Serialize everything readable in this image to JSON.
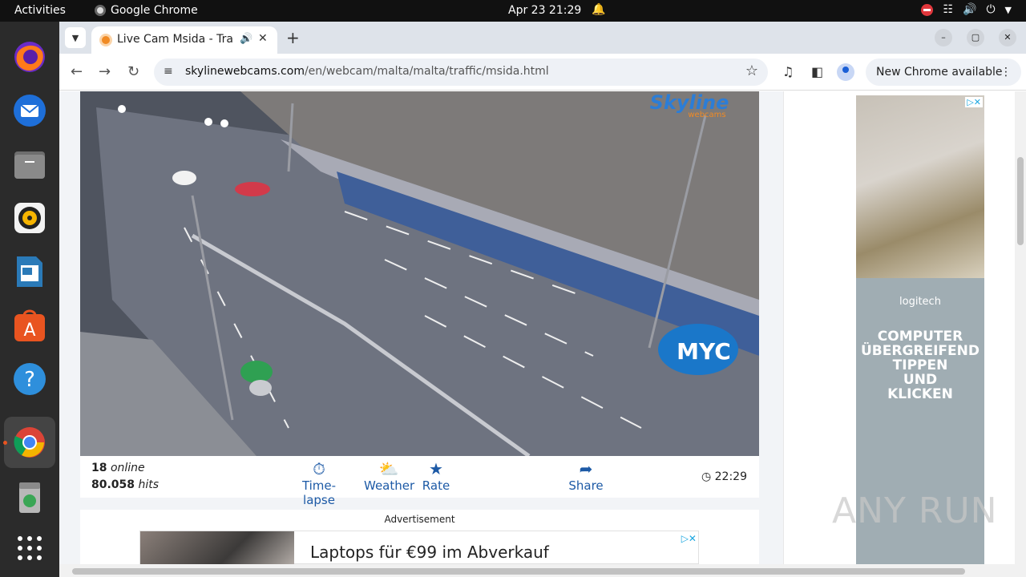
{
  "topbar": {
    "activities": "Activities",
    "app_name": "Google Chrome",
    "clock": "Apr 23  21:29"
  },
  "dock": {
    "items": [
      "firefox-icon",
      "thunderbird-icon",
      "files-icon",
      "rhythmbox-icon",
      "writer-icon",
      "app-center-icon",
      "help-icon",
      "chrome-icon",
      "trash-icon",
      "show-apps-icon"
    ]
  },
  "browser": {
    "tab_title": "Live Cam Msida - Traffic",
    "url_host": "skylinewebcams.com",
    "url_path": "/en/webcam/malta/malta/traffic/msida.html",
    "update_label": "New Chrome available"
  },
  "player": {
    "logo_main": "Skyline",
    "logo_sub": "webcams",
    "sponsor": "MYC"
  },
  "stats": {
    "online_count": "18",
    "online_label": "online",
    "hits_count": "80.058",
    "hits_label": "hits"
  },
  "actions": [
    {
      "label": "Time-lapse",
      "icon": "timelapse-icon"
    },
    {
      "label": "Weather",
      "icon": "weather-icon"
    },
    {
      "label": "Rate",
      "icon": "star-icon"
    },
    {
      "label": "Share",
      "icon": "share-icon"
    }
  ],
  "local_time": "22:29",
  "ad": {
    "label": "Advertisement",
    "headline": "Laptops für €99 im Abverkauf"
  },
  "side_ad": {
    "brand": "logitech",
    "copy": "COMPUTER\nÜBERGREIFEND\nTIPPEN\nUND\nKLICKEN"
  },
  "watermark": "ANY RUN"
}
